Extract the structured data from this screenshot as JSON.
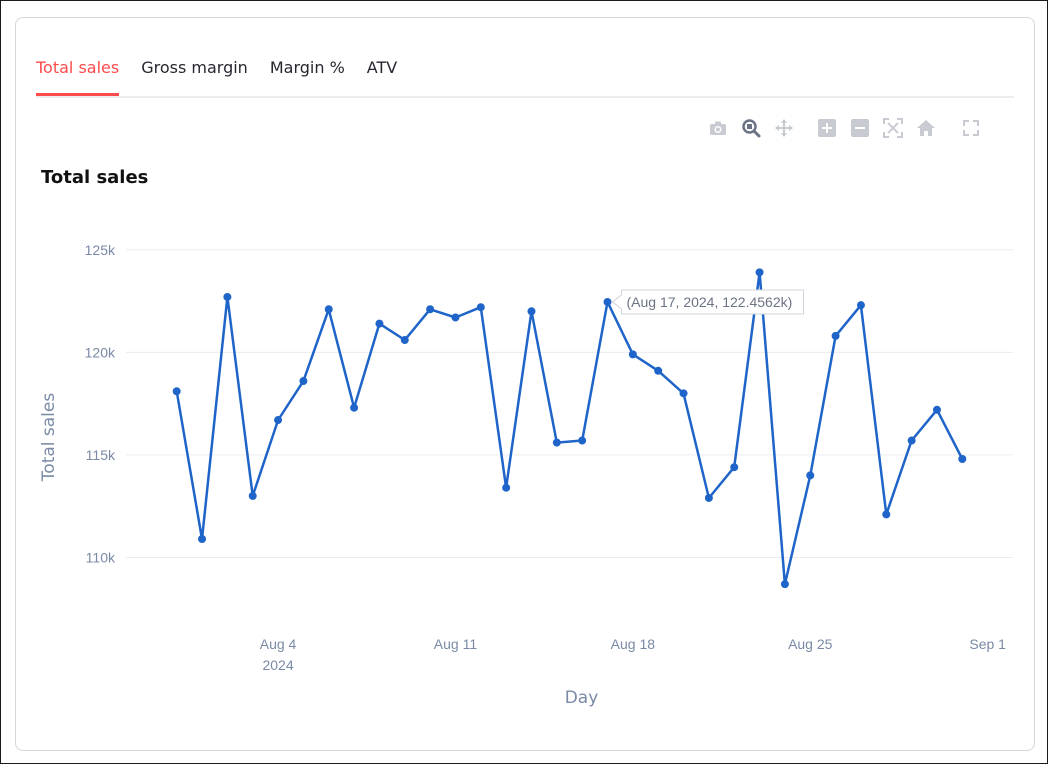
{
  "tabs": [
    {
      "label": "Total sales",
      "active": true
    },
    {
      "label": "Gross margin",
      "active": false
    },
    {
      "label": "Margin %",
      "active": false
    },
    {
      "label": "ATV",
      "active": false
    }
  ],
  "modebar": {
    "icons": [
      "camera-icon",
      "zoom-icon",
      "pan-icon",
      "zoom-in-icon",
      "zoom-out-icon",
      "autoscale-icon",
      "reset-axes-icon",
      "fullscreen-icon"
    ]
  },
  "colors": {
    "accent": "#ff4b4b",
    "line": "#1f64c8",
    "axis_text": "#7a8aa6",
    "grid": "#ececf0"
  },
  "chart_data": {
    "type": "line",
    "title": "Total sales",
    "xlabel": "Day",
    "ylabel": "Total sales",
    "x_tick_labels": [
      "Aug 4",
      "Aug 11",
      "Aug 18",
      "Aug 25",
      "Sep 1"
    ],
    "x_tick_dates": [
      "2024-08-04",
      "2024-08-11",
      "2024-08-18",
      "2024-08-25",
      "2024-09-01"
    ],
    "x_tick_sublabel": "2024",
    "y_tick_labels": [
      "110k",
      "115k",
      "120k",
      "125k"
    ],
    "y_tick_values": [
      110000,
      115000,
      120000,
      125000
    ],
    "ylim": [
      107000,
      126500
    ],
    "xlim": [
      "2024-07-29",
      "2024-09-02"
    ],
    "grid": true,
    "x": [
      "2024-07-31",
      "2024-08-01",
      "2024-08-02",
      "2024-08-03",
      "2024-08-04",
      "2024-08-05",
      "2024-08-06",
      "2024-08-07",
      "2024-08-08",
      "2024-08-09",
      "2024-08-10",
      "2024-08-11",
      "2024-08-12",
      "2024-08-13",
      "2024-08-14",
      "2024-08-15",
      "2024-08-16",
      "2024-08-17",
      "2024-08-18",
      "2024-08-19",
      "2024-08-20",
      "2024-08-21",
      "2024-08-22",
      "2024-08-23",
      "2024-08-24",
      "2024-08-25",
      "2024-08-26",
      "2024-08-27",
      "2024-08-28",
      "2024-08-29",
      "2024-08-30",
      "2024-08-31"
    ],
    "series": [
      {
        "values": [
          118100,
          110900,
          122700,
          113000,
          116700,
          118600,
          122100,
          117300,
          121400,
          120600,
          122100,
          121700,
          122200,
          113400,
          122000,
          115600,
          115700,
          122456.2,
          119900,
          119100,
          118000,
          112900,
          114400,
          123900,
          108700,
          114000,
          120800,
          122300,
          112100,
          115700,
          117200,
          114800
        ]
      }
    ],
    "tooltip": {
      "text": "(Aug 17, 2024, 122.4562k)",
      "point_index": 17
    }
  }
}
